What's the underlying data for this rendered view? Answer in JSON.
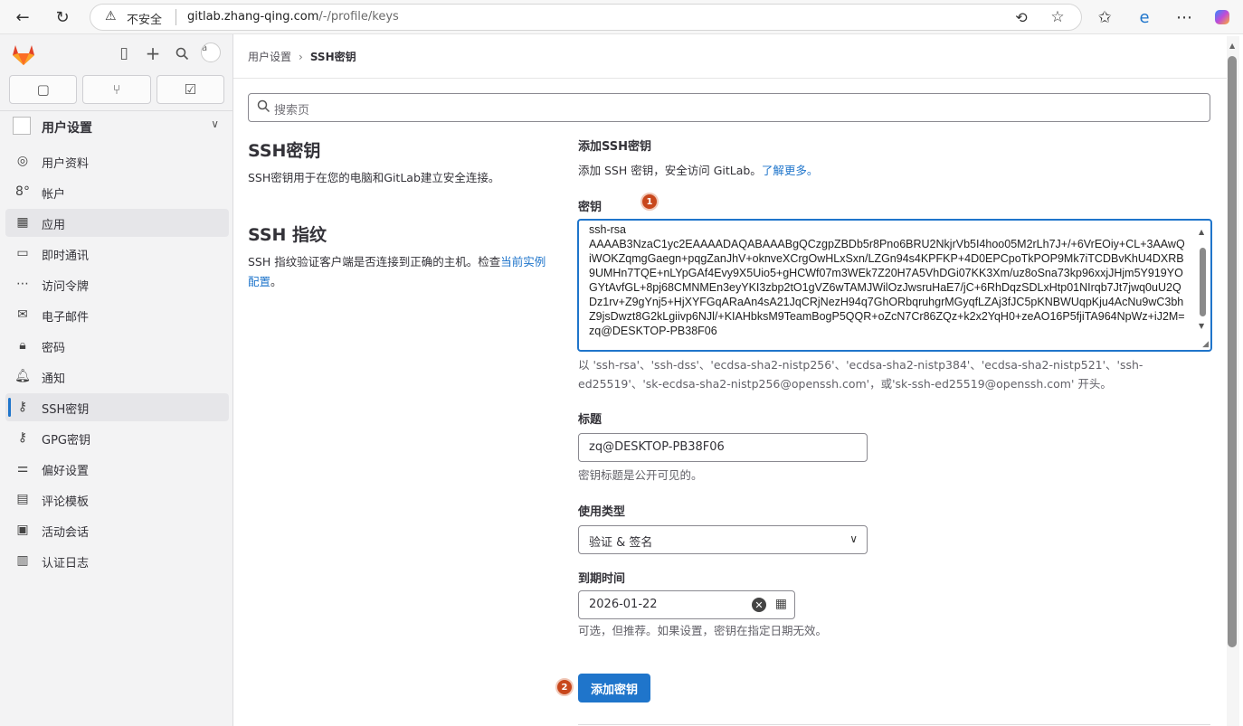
{
  "browser": {
    "insecure_label": "不安全",
    "url_host": "gitlab.zhang-qing.com",
    "url_path": "/-/profile/keys"
  },
  "sidebar": {
    "section_title": "用户设置",
    "avatar_alt": "a",
    "items": [
      {
        "label": "用户资料",
        "icon": "user-icon"
      },
      {
        "label": "帐户",
        "icon": "account-icon"
      },
      {
        "label": "应用",
        "icon": "apps-icon"
      },
      {
        "label": "即时通讯",
        "icon": "chat-icon"
      },
      {
        "label": "访问令牌",
        "icon": "token-icon"
      },
      {
        "label": "电子邮件",
        "icon": "mail-icon"
      },
      {
        "label": "密码",
        "icon": "lock-icon"
      },
      {
        "label": "通知",
        "icon": "bell-icon"
      },
      {
        "label": "SSH密钥",
        "icon": "key-icon"
      },
      {
        "label": "GPG密钥",
        "icon": "key-icon"
      },
      {
        "label": "偏好设置",
        "icon": "preferences-icon"
      },
      {
        "label": "评论模板",
        "icon": "comment-icon"
      },
      {
        "label": "活动会话",
        "icon": "monitor-icon"
      },
      {
        "label": "认证日志",
        "icon": "log-icon"
      }
    ]
  },
  "breadcrumb": {
    "parent": "用户设置",
    "current": "SSH密钥"
  },
  "search": {
    "placeholder": "搜索页"
  },
  "left": {
    "ssh_keys_title": "SSH密钥",
    "ssh_keys_desc": "SSH密钥用于在您的电脑和GitLab建立安全连接。",
    "fingerprint_title": "SSH 指纹",
    "fingerprint_desc": "SSH 指纹验证客户端是否连接到正确的主机。检查",
    "fingerprint_link": "当前实例配置",
    "fingerprint_end": "。"
  },
  "form": {
    "heading": "添加SSH密钥",
    "intro": "添加 SSH 密钥，安全访问 GitLab。",
    "learn_more": "了解更多",
    "intro_end": "。",
    "key_label": "密钥",
    "key_value": "ssh-rsa\nAAAAB3NzaC1yc2EAAAADAQABAAABgQCzgpZBDb5r8Pno6BRU2NkjrVb5I4hoo05M2rLh7J+/+6VrEOiy+CL+3AAwQiWOKZqmgGaegn+pqgZanJhV+oknveXCrgOwHLxSxn/LZGn94s4KPFKP+4D0EPCpoTkPOP9Mk7iTCDBvKhU4DXRB9UMHn7TQE+nLYpGAf4Evy9X5Uio5+gHCWf07m3WEk7Z20H7A5VhDGi07KK3Xm/uz8oSna73kp96xxjJHjm5Y919YOGYtAvfGL+8pj68CMNMEn3eyYKI3zbp2tO1gVZ6wTAMJWilOzJwsruHaE7/jC+6RhDqzSDLxHtp01NIrqb7Jt7jwq0uU2QDz1rv+Z9gYnj5+HjXYFGqARaAn4sA21JqCRjNezH94q7GhORbqruhgrMGyqfLZAj3fJC5pKNBWUqpKju4AcNu9wC3bhZ9jsDwzt8G2kLgiivp6NJl/+KIAHbksM9TeamBogP5QQR+oZcN7Cr86ZQz+k2x2YqH0+zeAO16P5fjiTA964NpWz+iJ2M=\nzq@DESKTOP-PB38F06",
    "key_hint": "以 'ssh-rsa'、'ssh-dss'、'ecdsa-sha2-nistp256'、'ecdsa-sha2-nistp384'、'ecdsa-sha2-nistp521'、'ssh-ed25519'、'sk-ecdsa-sha2-nistp256@openssh.com'，或'sk-ssh-ed25519@openssh.com' 开头。",
    "title_label": "标题",
    "title_value": "zq@DESKTOP-PB38F06",
    "title_hint": "密钥标题是公开可见的。",
    "usage_label": "使用类型",
    "usage_value": "验证 & 签名",
    "expiry_label": "到期时间",
    "expiry_value": "2026-01-22",
    "expiry_hint": "可选，但推荐。如果设置，密钥在指定日期无效。",
    "submit_label": "添加密钥",
    "badge_1": "1",
    "badge_2": "2"
  },
  "colors": {
    "primary": "#1f75cb",
    "badge": "#c8471c"
  }
}
